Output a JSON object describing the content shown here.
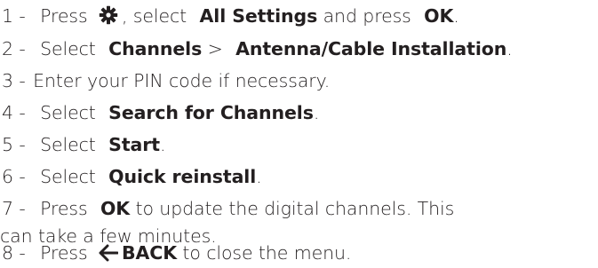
{
  "steps": [
    {
      "num": "1 -",
      "parts": {
        "a": "Press",
        "icon": "gear-icon",
        "b": ", select",
        "c": "All Settings",
        "d": "and press",
        "e": "OK",
        "f": "."
      }
    },
    {
      "num": "2 -",
      "parts": {
        "a": "Select",
        "b": "Channels",
        "c": ">",
        "d": "Antenna/Cable Installation",
        "e": "."
      }
    },
    {
      "num": "3 -",
      "parts": {
        "a": "Enter your PIN code if necessary."
      }
    },
    {
      "num": "4 -",
      "parts": {
        "a": "Select",
        "b": "Search for Channels",
        "c": "."
      }
    },
    {
      "num": "5 -",
      "parts": {
        "a": "Select",
        "b": "Start",
        "c": "."
      }
    },
    {
      "num": "6 -",
      "parts": {
        "a": "Select",
        "b": "Quick reinstall",
        "c": "."
      }
    },
    {
      "num": "7 -",
      "parts": {
        "a": "Press",
        "b": "OK",
        "c": "to update the digital channels. This",
        "d": "can take a few minutes."
      }
    },
    {
      "num": "8 -",
      "parts": {
        "a": "Press",
        "icon": "back-arrow-icon",
        "b": "BACK",
        "c": "to close the menu."
      }
    }
  ],
  "colors": {
    "text": "#231f20",
    "background": "#ffffff"
  }
}
